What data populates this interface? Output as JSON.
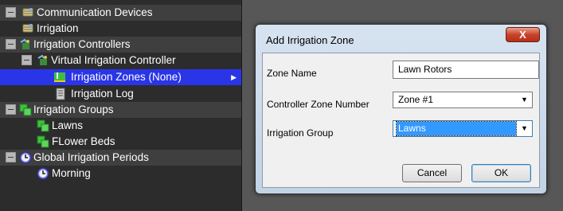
{
  "tree": {
    "items": [
      {
        "label": "Communication Devices",
        "icon": "network-devices-icon"
      },
      {
        "label": "Irrigation",
        "icon": "network-device-icon"
      },
      {
        "label": "Irrigation Controllers",
        "icon": "controller-icon"
      },
      {
        "label": "Virtual Irrigation Controller",
        "icon": "controller-icon"
      },
      {
        "label": "Irrigation Zones (None)",
        "icon": "zone-icon"
      },
      {
        "label": "Irrigation Log",
        "icon": "log-icon"
      },
      {
        "label": "Irrigation Groups",
        "icon": "group-icon"
      },
      {
        "label": "Lawns",
        "icon": "group-icon"
      },
      {
        "label": "FLower Beds",
        "icon": "group-icon"
      },
      {
        "label": "Global Irrigation Periods",
        "icon": "clock-icon"
      },
      {
        "label": "Morning",
        "icon": "clock-icon"
      }
    ]
  },
  "dialog": {
    "title": "Add Irrigation Zone",
    "close_label": "X",
    "zone_name": {
      "label": "Zone Name",
      "value": "Lawn Rotors"
    },
    "controller_zone": {
      "label": "Controller Zone Number",
      "value": "Zone #1"
    },
    "irrigation_group": {
      "label": "Irrigation Group",
      "value": "Lawns"
    },
    "cancel_label": "Cancel",
    "ok_label": "OK"
  },
  "colors": {
    "tree_bg": "#2c2c2c",
    "category_bg": "#3f3f3f",
    "selection": "#2a35e8",
    "dialog_frame": "#c2d3e6",
    "close_red": "#c8422a",
    "highlight": "#3399ff"
  }
}
